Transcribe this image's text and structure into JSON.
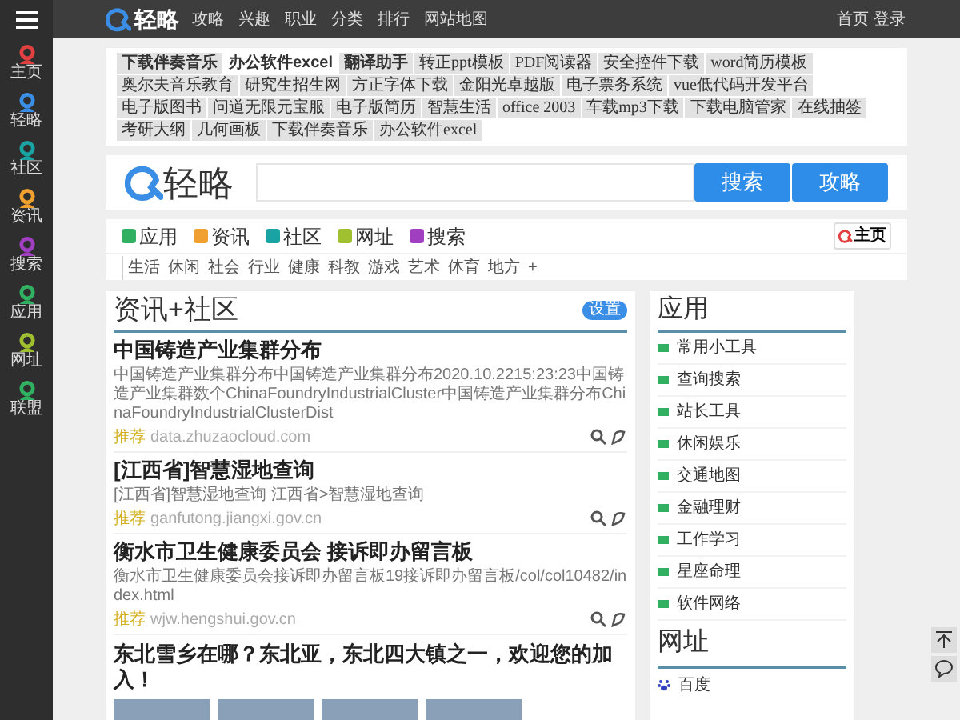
{
  "sidebar": {
    "items": [
      {
        "label": "主页",
        "color": "#e04040"
      },
      {
        "label": "轻略",
        "color": "#3a8ee6"
      },
      {
        "label": "社区",
        "color": "#1aa3a3"
      },
      {
        "label": "资讯",
        "color": "#f0a030"
      },
      {
        "label": "搜索",
        "color": "#a040c0"
      },
      {
        "label": "应用",
        "color": "#30b060"
      },
      {
        "label": "网址",
        "color": "#a0c030"
      },
      {
        "label": "联盟",
        "color": "#30b060"
      }
    ]
  },
  "topbar": {
    "logo": "轻略",
    "nav": [
      "攻略",
      "兴趣",
      "职业",
      "分类",
      "排行",
      "网站地图"
    ],
    "links": [
      "首页",
      "登录"
    ]
  },
  "tags": [
    {
      "label": "下载伴奏音乐",
      "bold": true,
      "selected": false
    },
    {
      "label": "办公软件excel",
      "bold": true,
      "selected": true
    },
    {
      "label": "翻译助手",
      "bold": true,
      "selected": false
    },
    {
      "label": "转正ppt模板",
      "bold": false,
      "selected": false
    },
    {
      "label": "PDF阅读器",
      "bold": false,
      "selected": false
    },
    {
      "label": "安全控件下载",
      "bold": false,
      "selected": false
    },
    {
      "label": "word简历模板",
      "bold": false,
      "selected": false
    },
    {
      "label": "奥尔夫音乐教育",
      "bold": false,
      "selected": false
    },
    {
      "label": "研究生招生网",
      "bold": false,
      "selected": false
    },
    {
      "label": "方正字体下载",
      "bold": false,
      "selected": false
    },
    {
      "label": "金阳光卓越版",
      "bold": false,
      "selected": false
    },
    {
      "label": "电子票务系统",
      "bold": false,
      "selected": false
    },
    {
      "label": "vue低代码开发平台",
      "bold": false,
      "selected": false
    },
    {
      "label": "电子版图书",
      "bold": false,
      "selected": false
    },
    {
      "label": "问道无限元宝服",
      "bold": false,
      "selected": false
    },
    {
      "label": "电子版简历",
      "bold": false,
      "selected": false
    },
    {
      "label": "智慧生活",
      "bold": false,
      "selected": false
    },
    {
      "label": "office 2003",
      "bold": false,
      "selected": false
    },
    {
      "label": "车载mp3下载",
      "bold": false,
      "selected": false
    },
    {
      "label": "下载电脑管家",
      "bold": false,
      "selected": false
    },
    {
      "label": "在线抽签",
      "bold": false,
      "selected": false
    },
    {
      "label": "考研大纲",
      "bold": false,
      "selected": false
    },
    {
      "label": "几何画板",
      "bold": false,
      "selected": false
    },
    {
      "label": "下载伴奏音乐",
      "bold": false,
      "selected": false
    },
    {
      "label": "办公软件excel",
      "bold": false,
      "selected": false
    }
  ],
  "search": {
    "logo": "轻略",
    "buttons": [
      "搜索",
      "攻略"
    ]
  },
  "channels": {
    "items": [
      {
        "label": "应用",
        "color": "#30b060"
      },
      {
        "label": "资讯",
        "color": "#f0a030"
      },
      {
        "label": "社区",
        "color": "#1aa3a3"
      },
      {
        "label": "网址",
        "color": "#a0c030"
      },
      {
        "label": "搜索",
        "color": "#a040c0"
      }
    ],
    "home_button": "主页",
    "categories": [
      "生活",
      "休闲",
      "社会",
      "行业",
      "健康",
      "科教",
      "游戏",
      "艺术",
      "体育",
      "地方",
      "+"
    ]
  },
  "feed": {
    "title": "资讯+社区",
    "settings": "设置",
    "articles": [
      {
        "title": "中国铸造产业集群分布",
        "summary": "中国铸造产业集群分布中国铸造产业集群分布2020.10.2215:23:23中国铸造产业集群数个ChinaFoundryIndustrialCluster中国铸造产业集群分布ChinaFoundryIndustrialClusterDist",
        "tag": "推荐",
        "source": "data.zhuzaocloud.com"
      },
      {
        "title": "[江西省]智慧湿地查询",
        "summary": "[江西省]智慧湿地查询 江西省>智慧湿地查询",
        "tag": "推荐",
        "source": "ganfutong.jiangxi.gov.cn"
      },
      {
        "title": "衡水市卫生健康委员会 接诉即办留言板",
        "summary": "衡水市卫生健康委员会接诉即办留言板19接诉即办留言板/col/col10482/index.html",
        "tag": "推荐",
        "source": "wjw.hengshui.gov.cn"
      }
    ],
    "gallery": {
      "title": "东北雪乡在哪？东北亚，东北四大镇之一，欢迎您的加入！"
    }
  },
  "apps": {
    "title": "应用",
    "items": [
      "常用小工具",
      "查询搜索",
      "站长工具",
      "休闲娱乐",
      "交通地图",
      "金融理财",
      "工作学习",
      "星座命理",
      "软件网络"
    ]
  },
  "sites": {
    "title": "网址",
    "items": [
      "百度"
    ]
  }
}
